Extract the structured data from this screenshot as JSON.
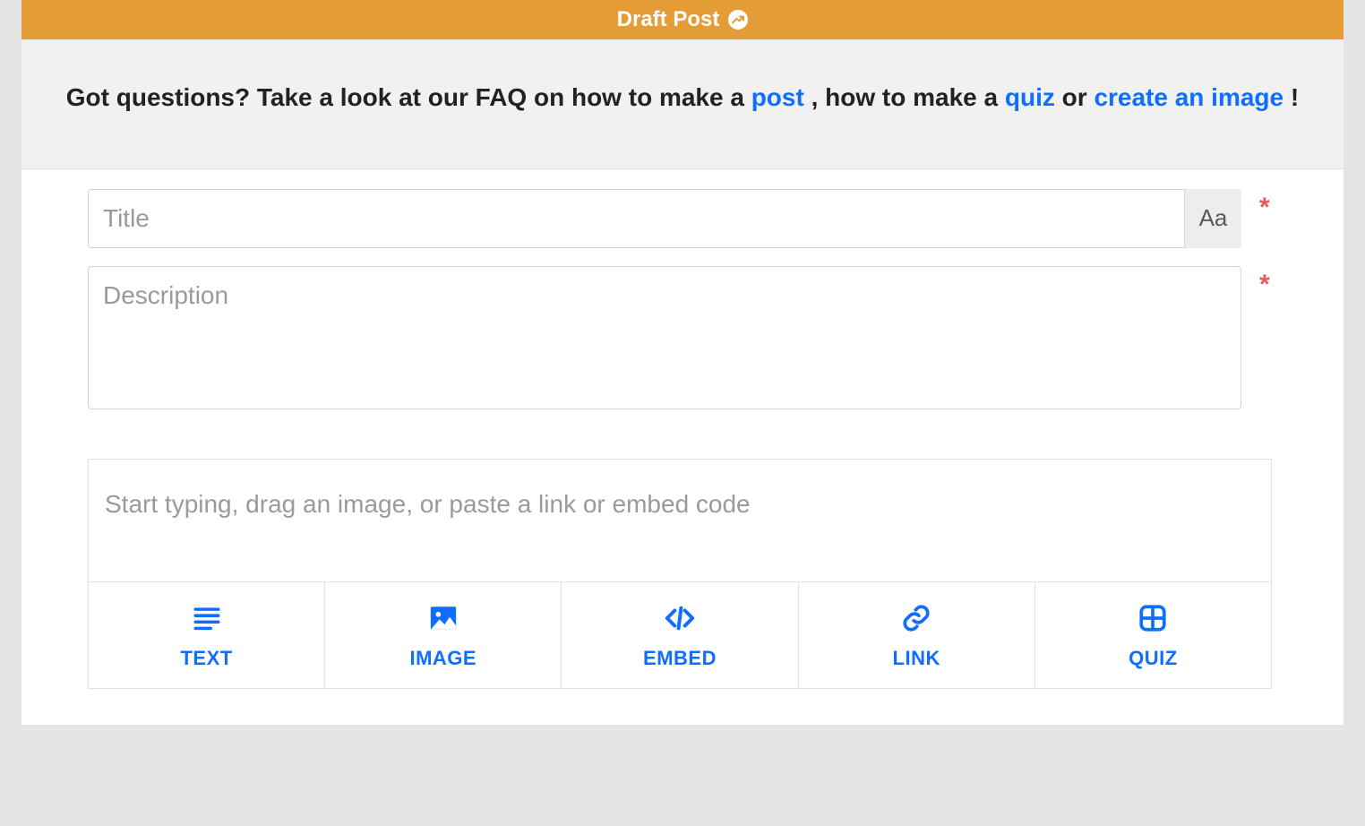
{
  "header": {
    "title": "Draft Post"
  },
  "faq": {
    "prefix": "Got questions? Take a look at our FAQ on how to make a ",
    "link_post": "post",
    "mid1": " , how to make a ",
    "link_quiz": "quiz",
    "mid2": " or ",
    "link_image": "create an image",
    "suffix": " !"
  },
  "title_field": {
    "placeholder": "Title",
    "value": "",
    "aa_label": "Aa"
  },
  "description_field": {
    "placeholder": "Description",
    "value": ""
  },
  "content_field": {
    "placeholder": "Start typing, drag an image, or paste a link or embed code",
    "value": ""
  },
  "toolbar": {
    "text": "TEXT",
    "image": "IMAGE",
    "embed": "EMBED",
    "link": "LINK",
    "quiz": "QUIZ"
  },
  "required_marker": "*"
}
